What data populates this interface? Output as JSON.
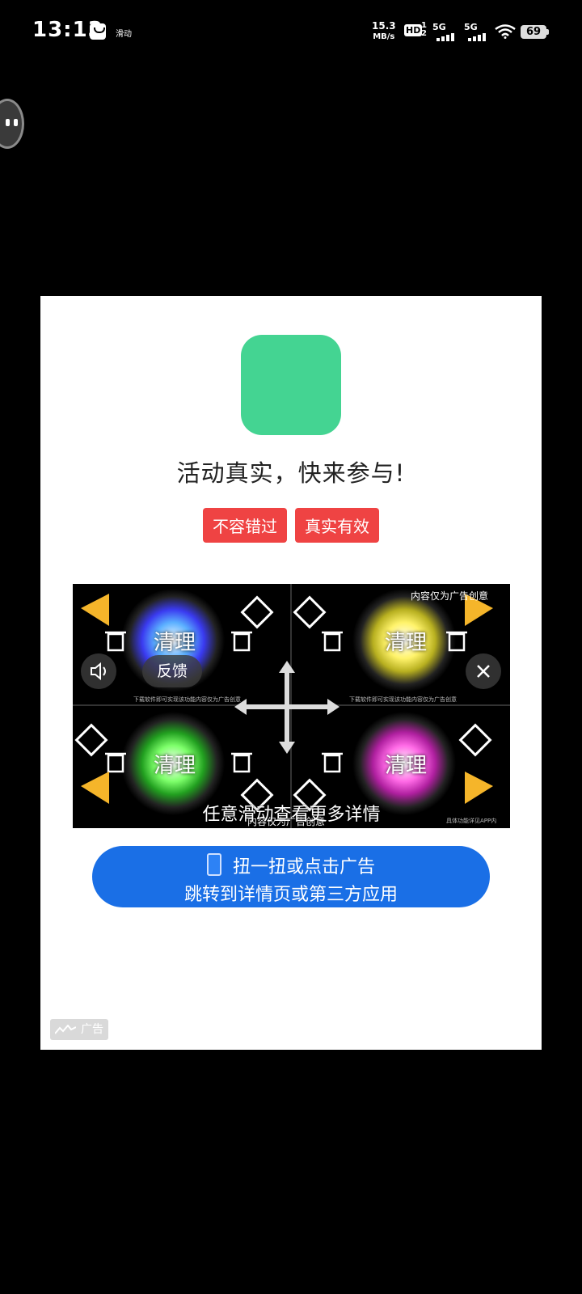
{
  "status_bar": {
    "time": "13:13",
    "notification_text": "滑动",
    "speed_value": "15.3",
    "speed_unit": "MB/s",
    "hd": "HD",
    "hd_sub": "1\n2",
    "net1": "5G",
    "net2": "5G",
    "battery": "69"
  },
  "ad": {
    "icon_color": "#44d492",
    "headline": "活动真实，快来参与!",
    "tags": [
      "不容错过",
      "真实有效"
    ],
    "video": {
      "caption_top": "内容仅为广告创意",
      "caption_bottom": "内容仅为广告创意",
      "tile_label": "清理",
      "small_text_1": "下载软件即可实现该功能内容仅为广告创意",
      "small_text_2": "具体功能详见APP内",
      "feedback": "反馈",
      "swipe_hint": "任意滑动查看更多详情"
    },
    "cta": {
      "line1": "扭一扭或点击广告",
      "line2": "跳转到详情页或第三方应用"
    },
    "badge": "广告"
  },
  "icons": [
    "bag-icon",
    "wifi-icon",
    "battery-icon",
    "volume-icon",
    "close-icon",
    "phone-shake-icon",
    "megaphone-icon",
    "trash-icon",
    "brush-icon"
  ]
}
